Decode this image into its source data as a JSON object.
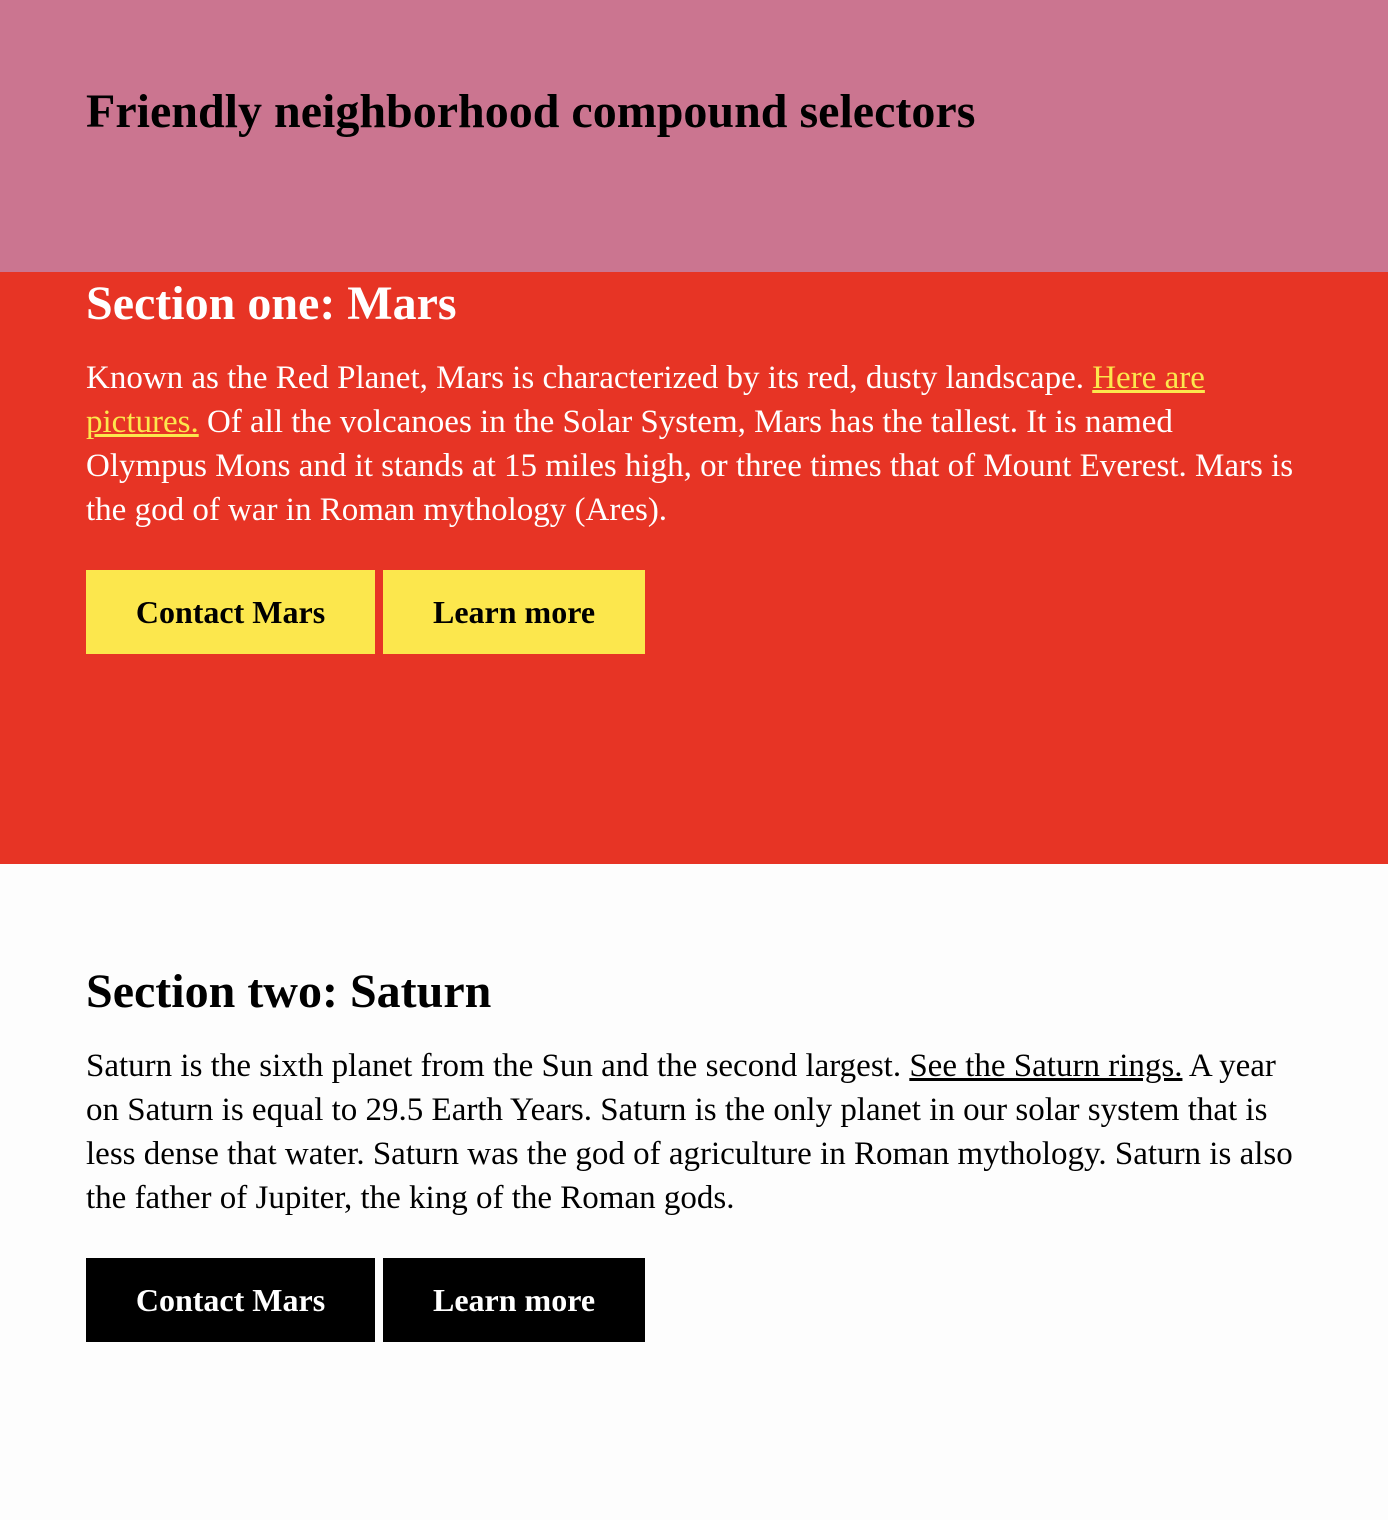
{
  "header": {
    "title": "Friendly neighborhood compound selectors"
  },
  "colors": {
    "header_bg": "#cb7590",
    "mars_bg": "#e73425",
    "mars_accent": "#fce74d",
    "saturn_bg": "#fdfdfd",
    "saturn_button_bg": "#000000"
  },
  "sections": {
    "mars": {
      "heading": "Section one: Mars",
      "text_before_link": "Known as the Red Planet, Mars is characterized by its red, dusty landscape. ",
      "link_text": "Here are pictures.",
      "text_after_link": " Of all the volcanoes in the Solar System, Mars has the tallest. It is named Olympus Mons and it stands at 15 miles high, or three times that of Mount Everest. Mars is the god of war in Roman mythology (Ares).",
      "buttons": {
        "contact": "Contact Mars",
        "learn": "Learn more"
      }
    },
    "saturn": {
      "heading": "Section two: Saturn",
      "text_before_link": "Saturn is the sixth planet from the Sun and the second largest. ",
      "link_text": "See the Saturn rings.",
      "text_after_link": " A year on Saturn is equal to 29.5 Earth Years. Saturn is the only planet in our solar system that is less dense that water. Saturn was the god of agriculture in Roman mythology. Saturn is also the father of Jupiter, the king of the Roman gods.",
      "buttons": {
        "contact": "Contact Mars",
        "learn": "Learn more"
      }
    }
  }
}
